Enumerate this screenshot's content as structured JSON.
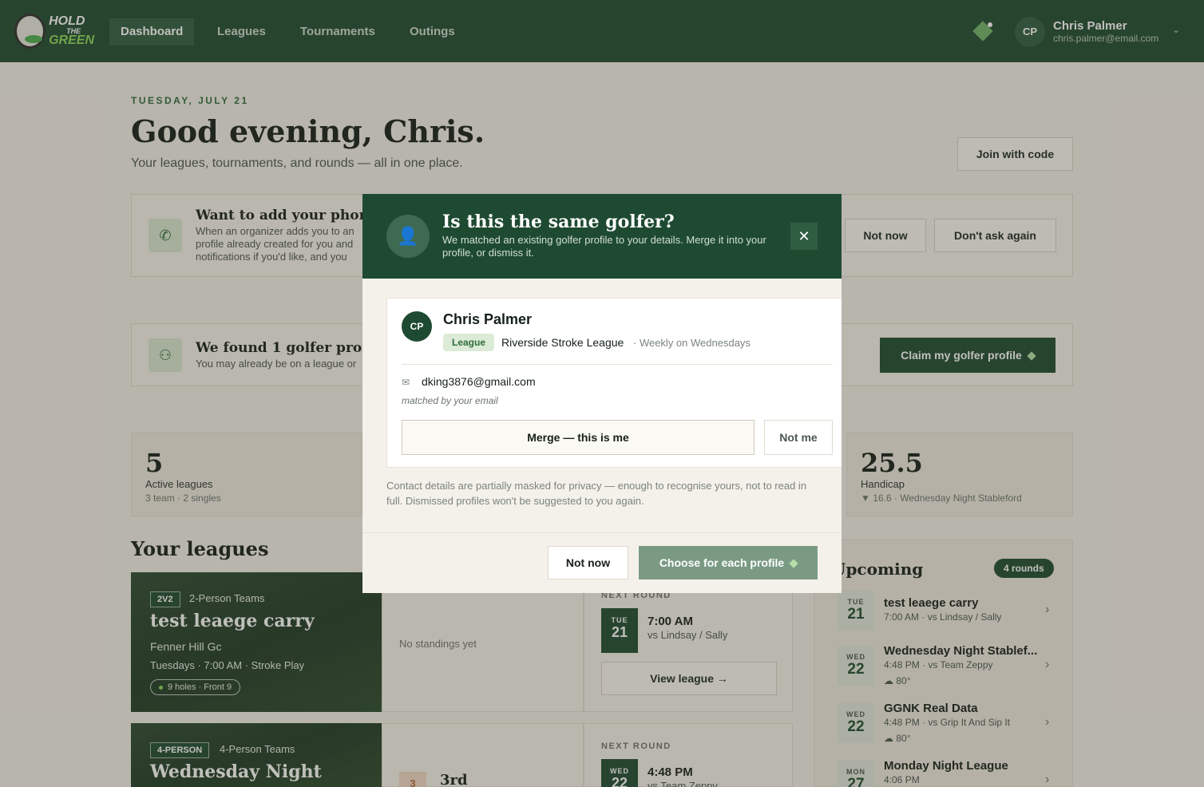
{
  "nav": {
    "logo_top": "HOLD",
    "logo_mid": "THE",
    "logo_bottom": "GREEN",
    "items": [
      {
        "label": "Dashboard",
        "active": true
      },
      {
        "label": "Leagues"
      },
      {
        "label": "Tournaments"
      },
      {
        "label": "Outings"
      }
    ],
    "user": {
      "initials": "CP",
      "name": "Chris Palmer",
      "email": "chris.palmer@email.com"
    }
  },
  "page": {
    "date": "TUESDAY, JULY 21",
    "greeting": "Good evening, Chris.",
    "subtitle": "Your leagues, tournaments, and rounds — all in one place.",
    "join_label": "Join with code"
  },
  "phone_banner": {
    "title": "Want to add your phone n",
    "lines": [
      "When an organizer adds you to an",
      "profile already created for you and",
      "notifications if you'd like, and you"
    ],
    "not_now": "Not now",
    "dont_ask": "Don't ask again"
  },
  "claim_banner": {
    "title": "We found 1 golfer profile",
    "text": "You may already be on a league or",
    "button": "Claim my golfer profile"
  },
  "stats": [
    {
      "value": "5",
      "label": "Active leagues",
      "sub": "3 team · 2 singles"
    },
    {
      "value": "25.5",
      "label": "Handicap",
      "sub": "▼ 16.6 · Wednesday Night Stableford"
    }
  ],
  "your_leagues": {
    "title": "Your leagues",
    "leagues": [
      {
        "badge": "2V2",
        "type": "2-Person Teams",
        "name": "test leaege carry",
        "course": "Fenner Hill Gc",
        "schedule": "Tuesdays · 7:00 AM · Stroke Play",
        "holes": "9 holes · Front 9",
        "standings": "No standings yet",
        "next_label": "NEXT ROUND",
        "dow": "TUE",
        "day": "21",
        "time": "7:00 AM",
        "vs": "vs Lindsay / Sally",
        "view": "View league →"
      },
      {
        "badge": "4-PERSON",
        "type": "4-Person Teams",
        "name": "Wednesday Night",
        "rank_num": "3",
        "rank": "3rd",
        "next_label": "NEXT ROUND",
        "dow": "WED",
        "day": "22",
        "time": "4:48 PM",
        "vs": "vs Team Zeppy"
      }
    ]
  },
  "upcoming": {
    "title": "Upcoming",
    "count": "4 rounds",
    "items": [
      {
        "dow": "TUE",
        "day": "21",
        "title": "test leaege carry",
        "sub": "7:00 AM · vs Lindsay / Sally"
      },
      {
        "dow": "WED",
        "day": "22",
        "title": "Wednesday Night Stablef...",
        "sub": "4:48 PM · vs Team Zeppy",
        "weather": "80°"
      },
      {
        "dow": "WED",
        "day": "22",
        "title": "GGNK Real Data",
        "sub": "4:48 PM · vs Grip It And Sip It",
        "weather": "80°"
      },
      {
        "dow": "MON",
        "day": "27",
        "title": "Monday Night League",
        "sub": "4:06 PM"
      }
    ]
  },
  "modal": {
    "title": "Is this the same golfer?",
    "subtitle": "We matched an existing golfer profile to your details. Merge it into your profile, or dismiss it.",
    "profile": {
      "initials": "CP",
      "name": "Chris Palmer",
      "tag": "League",
      "league": "Riverside Stroke League",
      "schedule": "· Weekly on Wednesdays",
      "email": "dking3876@gmail.com",
      "matched": "matched by your email"
    },
    "merge_label": "Merge — this is me",
    "not_me_label": "Not me",
    "note": "Contact details are partially masked for privacy — enough to recognise yours, not to read in full. Dismissed profiles won't be suggested to you again.",
    "not_now_label": "Not now",
    "choose_label": "Choose for each profile"
  }
}
